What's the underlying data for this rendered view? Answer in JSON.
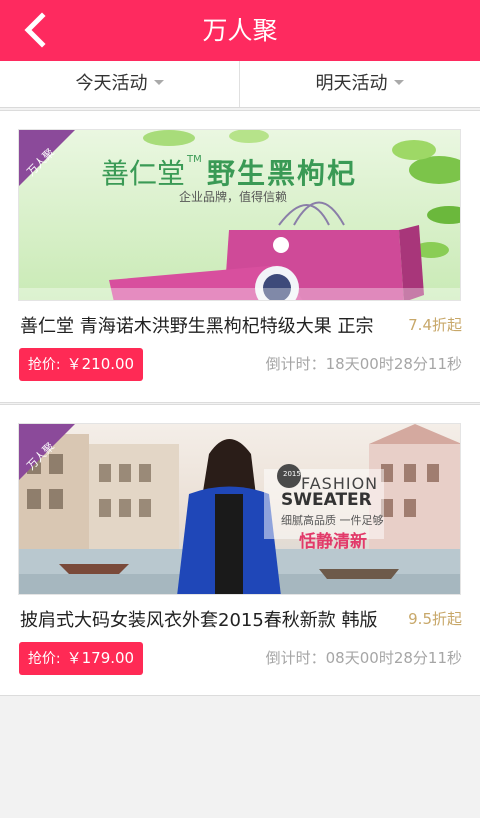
{
  "header": {
    "title": "万人聚",
    "accent_color": "#fe2a5f",
    "back_icon": "chevron-left-icon"
  },
  "tabs": [
    {
      "label": "今天活动"
    },
    {
      "label": "明天活动"
    }
  ],
  "badge_label": "万人聚",
  "products": [
    {
      "title": "善仁堂 青海诺木洪野生黑枸杞特级大果 正宗",
      "discount": "7.4折起",
      "price_label": "抢价:",
      "price": "￥210.00",
      "countdown": "倒计时：18天00时28分11秒",
      "banner": {
        "brand": "善仁堂",
        "tm": "TM",
        "headline": "野生黑枸杞",
        "slogan": "企业品牌，值得信赖"
      }
    },
    {
      "title": "披肩式大码女装风衣外套2015春秋新款 韩版",
      "discount": "9.5折起",
      "price_label": "抢价:",
      "price": "￥179.00",
      "countdown": "倒计时：08天00时28分11秒",
      "banner": {
        "word1": "FASHION",
        "word2": "SWEATER",
        "year": "2015",
        "line1": "细腻高品质 一件足够",
        "line2": "恬静清新"
      }
    }
  ]
}
